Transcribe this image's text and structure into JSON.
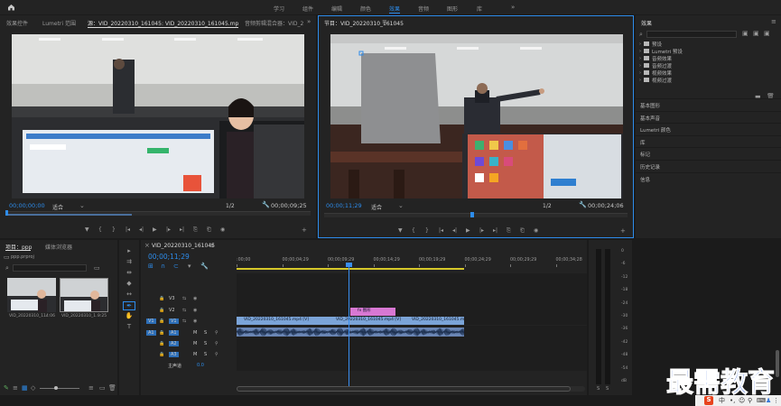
{
  "topbar": {
    "tabs": [
      "学习",
      "组件",
      "编辑",
      "颜色",
      "效果",
      "音频",
      "图形",
      "库"
    ],
    "active_tab": 4
  },
  "source_monitor": {
    "tabs": [
      "效果控件",
      "Lumetri 范围",
      "源：VID_20220310_161045: VID_20220310_161045.mp4: 00;00;00;00",
      "音频剪辑混合器：VID_2C"
    ],
    "timecode_left": "00;00;00;00",
    "fit_label": "适合",
    "ratio": "1/2",
    "timecode_right": "00;00;09;25"
  },
  "program_monitor": {
    "title": "节目：VID_20220310_161045",
    "timecode_left": "00;00;11;29",
    "fit_label": "适合",
    "ratio": "1/2",
    "timecode_right": "00;00;24;06"
  },
  "effects_panel": {
    "title": "效果",
    "items": [
      "预设",
      "Lumetri 预设",
      "音频效果",
      "音频过渡",
      "视频效果",
      "视频过渡"
    ],
    "sections": [
      "基本图形",
      "基本声音",
      "Lumetri 颜色",
      "库",
      "标记",
      "历史记录",
      "信息"
    ]
  },
  "project_panel": {
    "tabs": [
      "项目：ppp",
      "媒体浏览器"
    ],
    "file": "ppp.prproj",
    "thumbs": [
      "VID_20220310_1...",
      "VID_20220310_1..."
    ],
    "durations": [
      "14:06",
      "9:25"
    ]
  },
  "timeline": {
    "tab": "VID_20220310_161045",
    "timecode": "00;00;11;29",
    "ruler": [
      ":00;00",
      "00;00;04;29",
      "00;00;09;29",
      "00;00;14;29",
      "00;00;19;29",
      "00;00;24;29",
      "00;00;29;29",
      "00;00;34;28"
    ],
    "video_tracks": [
      "V3",
      "V2",
      "V1"
    ],
    "audio_tracks": [
      "A1",
      "A2",
      "A3"
    ],
    "master_label": "主声道",
    "master_value": "0.0",
    "title_clip": "fx 图形",
    "clips": [
      "VID_20220310_161045.mp4 [V]",
      "VID_20220310_161045.mp4 [V]",
      "VID_20220310_161045.mp4"
    ]
  },
  "meters": {
    "scale": [
      "0",
      "-6",
      "-12",
      "-18",
      "-24",
      "-30",
      "-36",
      "-42",
      "-48",
      "-54",
      "dB"
    ],
    "solo": [
      "S",
      "S"
    ]
  },
  "watermark": "最需教育",
  "colors": {
    "accent": "#2d8ceb",
    "clip": "#7ba4d8",
    "graphic_clip": "#d878d3",
    "playhead": "#3a8ef0"
  }
}
